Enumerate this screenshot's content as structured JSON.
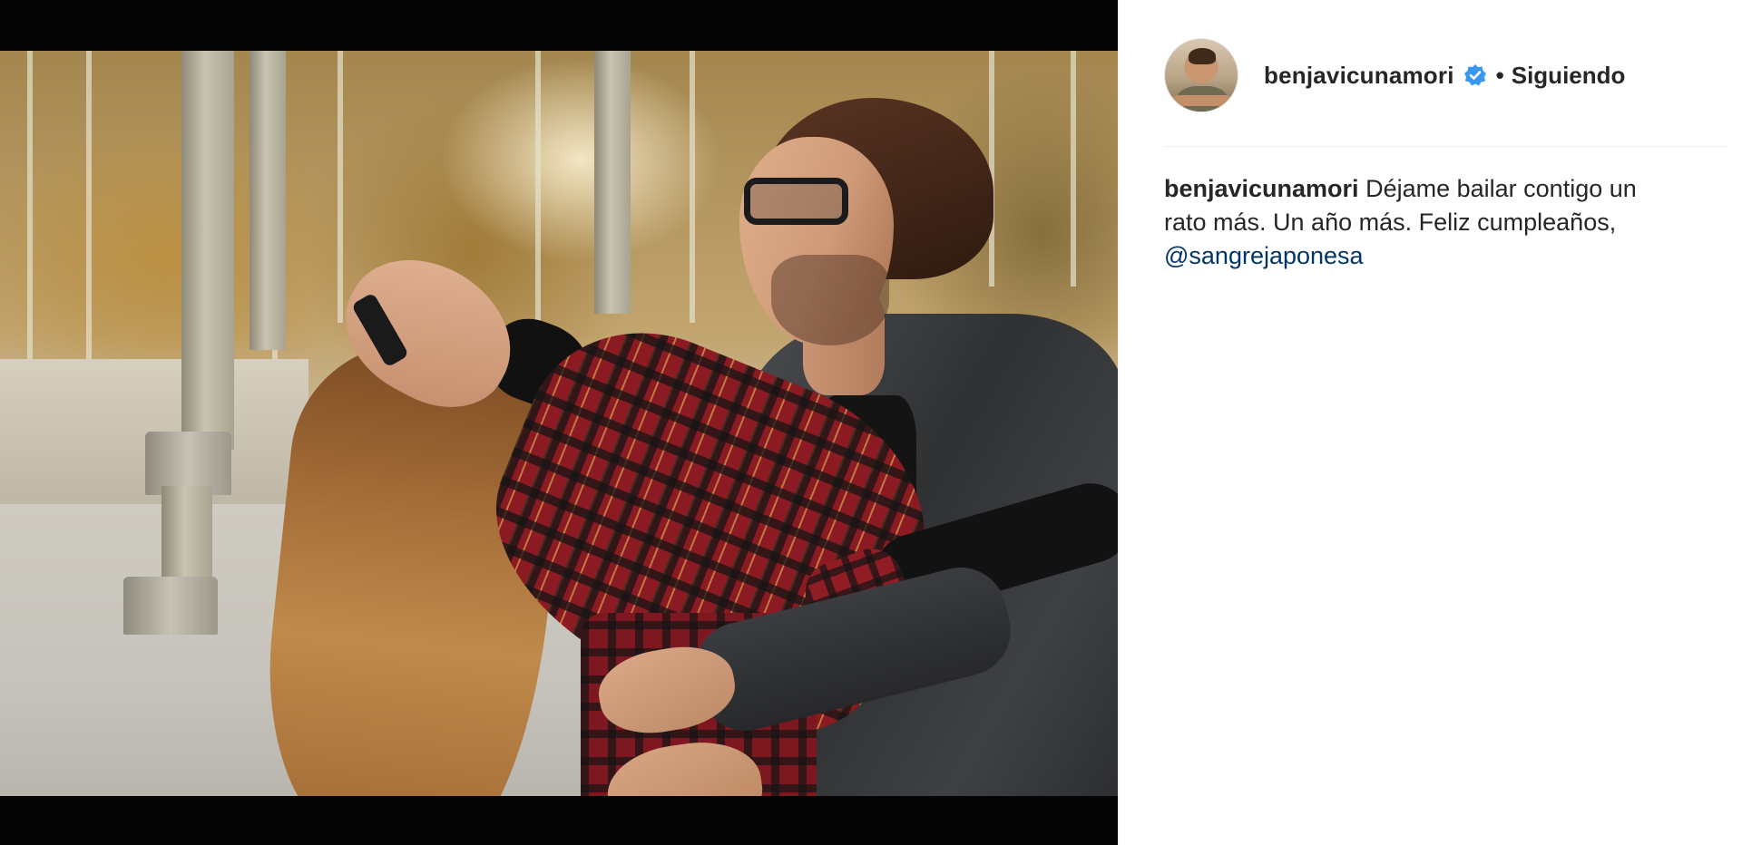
{
  "post": {
    "media": {
      "alt_subject": "photo",
      "colors": {
        "letterbox": "#050505"
      }
    },
    "header": {
      "avatar": "profile-avatar",
      "username": "benjavicunamori",
      "verified_icon": "verified-badge-icon",
      "separator": "•",
      "follow_status": "Siguiendo"
    },
    "caption": {
      "username": "benjavicunamori",
      "text": "Déjame bailar contigo un rato más. Un año más. Feliz cumpleaños,",
      "mention": "@sangrejaponesa"
    },
    "colors": {
      "text": "#262626",
      "mention": "#003569",
      "verified": "#3897f0",
      "divider": "#efefef"
    }
  }
}
